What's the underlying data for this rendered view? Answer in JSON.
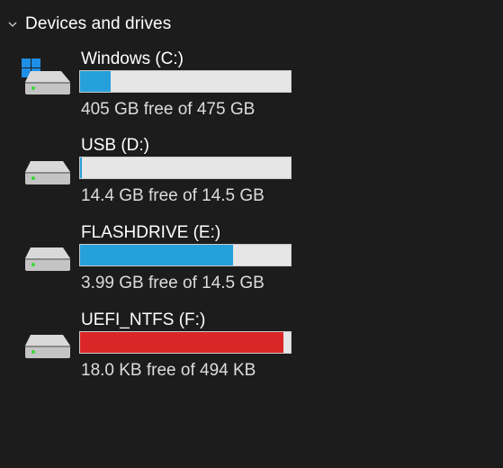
{
  "section": {
    "title": "Devices and drives"
  },
  "drives": [
    {
      "name": "Windows (C:)",
      "free_text": "405 GB free of 475 GB",
      "used_fraction": 0.147,
      "state": "normal",
      "is_system": true
    },
    {
      "name": "USB (D:)",
      "free_text": "14.4 GB free of 14.5 GB",
      "used_fraction": 0.01,
      "state": "normal",
      "is_system": false
    },
    {
      "name": "FLASHDRIVE (E:)",
      "free_text": "3.99 GB free of 14.5 GB",
      "used_fraction": 0.725,
      "state": "normal",
      "is_system": false
    },
    {
      "name": "UEFI_NTFS (F:)",
      "free_text": "18.0 KB free of 494 KB",
      "used_fraction": 0.964,
      "state": "full",
      "is_system": false
    }
  ],
  "colors": {
    "background": "#1c1c1c",
    "bar_normal": "#26a0da",
    "bar_full": "#da2626",
    "bar_track": "#e6e6e6"
  },
  "icons": {
    "section_toggle": "chevron-down-icon",
    "drive": "hard-drive-icon",
    "system_badge": "windows-logo-icon"
  }
}
